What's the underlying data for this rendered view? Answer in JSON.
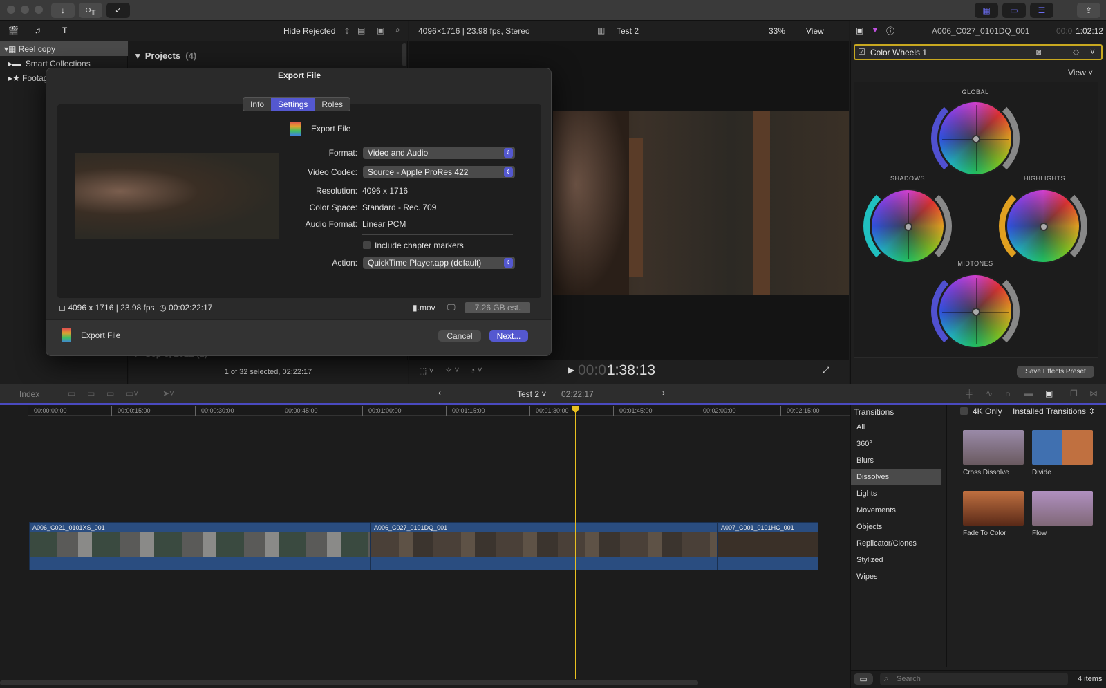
{
  "titlebar": {
    "icons": [
      "download-icon",
      "key-icon",
      "checkmark-icon"
    ],
    "right_icons": [
      "browser-grid-icon",
      "timeline-icon",
      "inspector-sliders-icon",
      "share-icon"
    ]
  },
  "browser": {
    "filter": "Hide Rejected",
    "projects_label": "Projects",
    "projects_count": "(4)",
    "date_group": "Sep 8, 2022",
    "count_label": "(2)",
    "status": "1 of 32 selected, 02:22:17"
  },
  "sidebar": {
    "items": [
      {
        "label": "Reel copy",
        "selected": true
      },
      {
        "label": "Smart Collections"
      },
      {
        "label": "Footage"
      }
    ]
  },
  "viewer": {
    "format": "4096×1716 | 23.98 fps, Stereo",
    "project": "Test 2",
    "zoom": "33%",
    "view": "View",
    "timecode_dim": "00:0",
    "timecode": "1:38:13"
  },
  "inspector": {
    "clip_name": "A006_C027_0101DQ_001",
    "timecode_dim": "00:0",
    "timecode": "1:02:12",
    "effect": "Color Wheels 1",
    "view": "View",
    "wheels": [
      "GLOBAL",
      "SHADOWS",
      "HIGHLIGHTS",
      "MIDTONES"
    ],
    "save_preset": "Save Effects Preset"
  },
  "dialog": {
    "title": "Export File",
    "tabs": [
      "Info",
      "Settings",
      "Roles"
    ],
    "active_tab": "Settings",
    "header": "Export File",
    "fields": {
      "format_label": "Format:",
      "format": "Video and Audio",
      "codec_label": "Video Codec:",
      "codec": "Source - Apple ProRes 422",
      "resolution_label": "Resolution:",
      "resolution": "4096 x 1716",
      "colorspace_label": "Color Space:",
      "colorspace": "Standard - Rec. 709",
      "audio_label": "Audio Format:",
      "audio": "Linear PCM",
      "chapter": "Include chapter markers",
      "chapter_checked": false,
      "action_label": "Action:",
      "action": "QuickTime Player.app (default)"
    },
    "summary": {
      "dims": "4096 x 1716",
      "fps": "23.98 fps",
      "duration": "00:02:22:17",
      "ext": ".mov",
      "size": "7.26 GB est."
    },
    "footer_label": "Export File",
    "cancel": "Cancel",
    "next": "Next..."
  },
  "timeline": {
    "index": "Index",
    "project": "Test 2",
    "duration": "02:22:17",
    "ruler": [
      "00:00:00:00",
      "00:00:15:00",
      "00:00:30:00",
      "00:00:45:00",
      "00:01:00:00",
      "00:01:15:00",
      "00:01:30:00",
      "00:01:45:00",
      "00:02:00:00",
      "00:02:15:00"
    ],
    "clips": [
      "A006_C021_0101XS_001",
      "A006_C027_0101DQ_001",
      "A007_C001_0101HC_001"
    ]
  },
  "transitions": {
    "title": "Transitions",
    "filter_4k": "4K Only",
    "source": "Installed Transitions",
    "categories": [
      "All",
      "360°",
      "Blurs",
      "Dissolves",
      "Lights",
      "Movements",
      "Objects",
      "Replicator/Clones",
      "Stylized",
      "Wipes"
    ],
    "selected": "Dissolves",
    "items": [
      "Cross Dissolve",
      "Divide",
      "Fade To Color",
      "Flow"
    ],
    "search_placeholder": "Search",
    "count": "4 items"
  },
  "colors": {
    "accent": "#5458d0",
    "playhead": "#e8c020",
    "clip": "#2a4d80",
    "effect_border": "#c8a820"
  }
}
